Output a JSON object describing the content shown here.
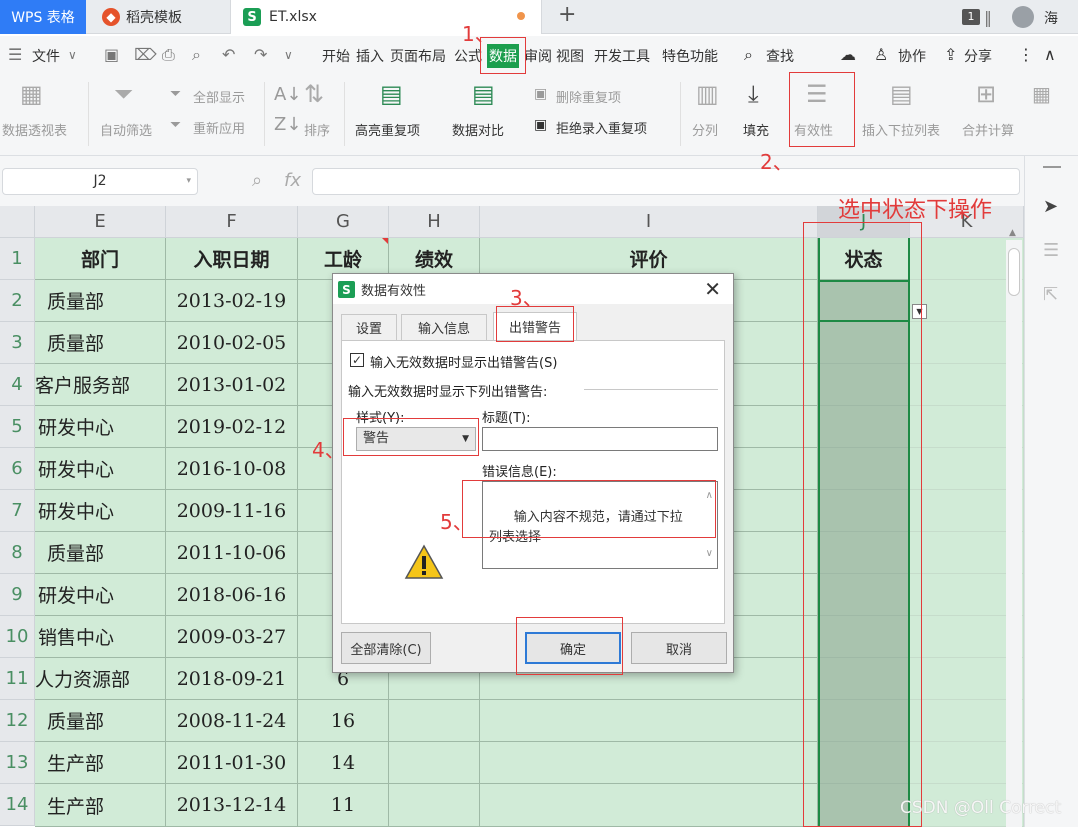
{
  "tabs": {
    "wps": "WPS 表格",
    "template": "稻壳模板",
    "file": "ET.xlsx",
    "new_tab": "+",
    "window_count": "1",
    "user": "海"
  },
  "menu": {
    "file": "文件",
    "items": [
      "开始",
      "插入",
      "页面布局",
      "公式",
      "数据",
      "审阅",
      "视图",
      "开发工具",
      "特色功能"
    ],
    "search": "查找",
    "collab": "协作",
    "share": "分享"
  },
  "ribbon": {
    "pivot": "数据透视表",
    "autofilter": "自动筛选",
    "show_all": "全部显示",
    "reapply": "重新应用",
    "sort": "排序",
    "highlight_dup": "高亮重复项",
    "compare": "数据对比",
    "delete_dup": "删除重复项",
    "reject_dup": "拒绝录入重复项",
    "split": "分列",
    "fill": "填充",
    "validity": "有效性",
    "insert_dropdown": "插入下拉列表",
    "consolidate": "合并计算"
  },
  "formula": {
    "cell_ref": "J2",
    "fx": "fx"
  },
  "sheet": {
    "columns": [
      "E",
      "F",
      "G",
      "H",
      "I",
      "J",
      "K"
    ],
    "headers": [
      "部门",
      "入职日期",
      "工龄",
      "绩效",
      "评价",
      "状态"
    ],
    "rows": [
      {
        "num": "1"
      },
      {
        "num": "2",
        "dept": "质量部",
        "date": "2013-02-19",
        "years": ""
      },
      {
        "num": "3",
        "dept": "质量部",
        "date": "2010-02-05",
        "years": ""
      },
      {
        "num": "4",
        "dept": "客户服务部",
        "date": "2013-01-02",
        "years": ""
      },
      {
        "num": "5",
        "dept": "研发中心",
        "date": "2019-02-12",
        "years": ""
      },
      {
        "num": "6",
        "dept": "研发中心",
        "date": "2016-10-08",
        "years": ""
      },
      {
        "num": "7",
        "dept": "研发中心",
        "date": "2009-11-16",
        "years": ""
      },
      {
        "num": "8",
        "dept": "质量部",
        "date": "2011-10-06",
        "years": ""
      },
      {
        "num": "9",
        "dept": "研发中心",
        "date": "2018-06-16",
        "years": ""
      },
      {
        "num": "10",
        "dept": "销售中心",
        "date": "2009-03-27",
        "years": ""
      },
      {
        "num": "11",
        "dept": "人力资源部",
        "date": "2018-09-21",
        "years": "6"
      },
      {
        "num": "12",
        "dept": "质量部",
        "date": "2008-11-24",
        "years": "16"
      },
      {
        "num": "13",
        "dept": "生产部",
        "date": "2011-01-30",
        "years": "14"
      },
      {
        "num": "14",
        "dept": "生产部",
        "date": "2013-12-14",
        "years": "11"
      }
    ]
  },
  "dialog": {
    "title": "数据有效性",
    "tabs": [
      "设置",
      "输入信息",
      "出错警告"
    ],
    "show_error_checkbox": "输入无效数据时显示出错警告(S)",
    "section_label": "输入无效数据时显示下列出错警告:",
    "style_label": "样式(Y):",
    "style_value": "警告",
    "title_label": "标题(T):",
    "title_value": "",
    "error_msg_label": "错误信息(E):",
    "error_msg_value": "输入内容不规范，请通过下拉列表选择",
    "clear_all": "全部清除(C)",
    "ok": "确定",
    "cancel": "取消"
  },
  "annotations": {
    "step1": "1、",
    "step2": "2、",
    "step3": "3、",
    "step4": "4、",
    "step5": "5、",
    "note": "选中状态下操作"
  },
  "watermark": "CSDN @Oll Correct",
  "colors": {
    "accent_green": "#1c9e4e",
    "annotation_red": "#e23b3b",
    "cell_green": "#d1ebd7",
    "selected_cell": "#a9c3ae"
  }
}
